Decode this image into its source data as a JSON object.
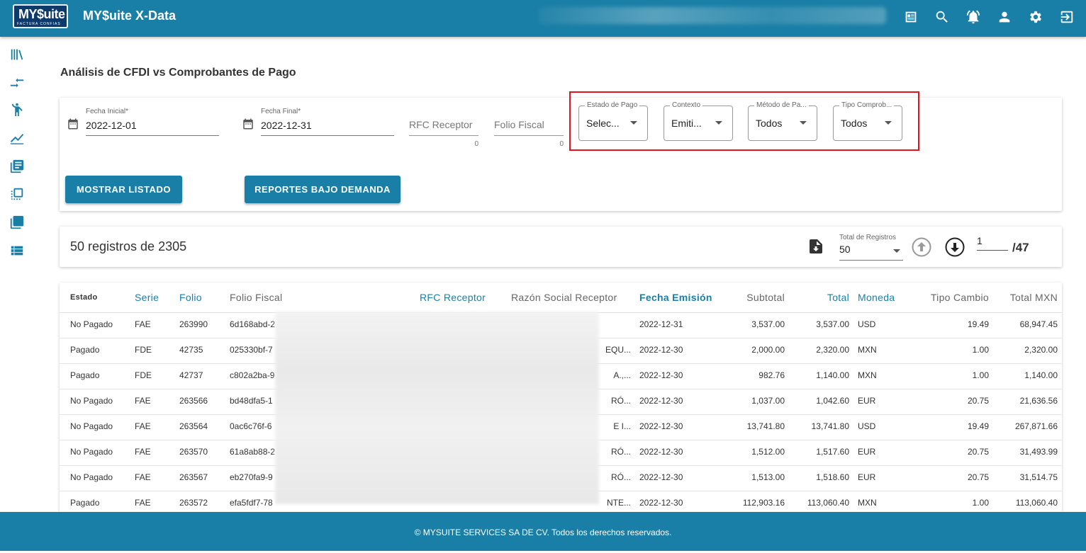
{
  "app": {
    "logo_text": "MY$uite",
    "logo_tagline": "FACTURA CONFIAS",
    "title": "MY$uite X-Data"
  },
  "colors": {
    "primary": "#1a7fa6",
    "highlight": "#e0141e"
  },
  "header_icons": [
    "news-icon",
    "search-icon",
    "notification-bell-icon",
    "user-icon",
    "gear-icon",
    "logout-icon"
  ],
  "sidebar_icons": [
    "library-icon",
    "swap-arrows-icon",
    "person-icon",
    "line-chart-icon",
    "library-books-icon",
    "flip-to-front-icon",
    "layers-icon",
    "list-icon"
  ],
  "page": {
    "title": "Análisis de CFDI vs Comprobantes de Pago"
  },
  "filters": {
    "fecha_inicial": {
      "label": "Fecha Inicial*",
      "value": "2022-12-01"
    },
    "fecha_final": {
      "label": "Fecha Final*",
      "value": "2022-12-31"
    },
    "rfc_receptor": {
      "placeholder": "RFC Receptor",
      "count": "0"
    },
    "folio_fiscal": {
      "placeholder": "Folio Fiscal",
      "count": "0"
    },
    "estado_pago": {
      "label": "Estado de Pago",
      "value": "Selec..."
    },
    "contexto": {
      "label": "Contexto",
      "value": "Emiti..."
    },
    "metodo_pago": {
      "label": "Método de Pa...",
      "value": "Todos"
    },
    "tipo_comprobante": {
      "label": "Tipo Comprob...",
      "value": "Todos"
    }
  },
  "actions": {
    "mostrar": "MOSTRAR LISTADO",
    "reportes": "REPORTES BAJO DEMANDA"
  },
  "summary": {
    "count_text": "50 registros de 2305",
    "total_label": "Total de Registros",
    "per_page": "50",
    "current_page": "1",
    "total_pages": "/47"
  },
  "table": {
    "columns": [
      "Estado",
      "Serie",
      "Folio",
      "Folio Fiscal",
      "RFC Receptor",
      "Razón Social Receptor",
      "Fecha Emisión",
      "Subtotal",
      "Total",
      "Moneda",
      "Tipo Cambio",
      "Total MXN"
    ],
    "rows": [
      [
        "No Pagado",
        "FAE",
        "263990",
        "6d168abd-2",
        "",
        "",
        "2022-12-31",
        "3,537.00",
        "3,537.00",
        "USD",
        "19.49",
        "68,947.45"
      ],
      [
        "Pagado",
        "FDE",
        "42735",
        "025330bf-7",
        "",
        "EQU...",
        "2022-12-30",
        "2,000.00",
        "2,320.00",
        "MXN",
        "1.00",
        "2,320.00"
      ],
      [
        "Pagado",
        "FDE",
        "42737",
        "c802a2ba-9",
        "",
        "A.,...",
        "2022-12-30",
        "982.76",
        "1,140.00",
        "MXN",
        "1.00",
        "1,140.00"
      ],
      [
        "No Pagado",
        "FAE",
        "263566",
        "bd48dfa5-1",
        "",
        "RÓ...",
        "2022-12-30",
        "1,037.00",
        "1,042.60",
        "EUR",
        "20.75",
        "21,636.56"
      ],
      [
        "No Pagado",
        "FAE",
        "263564",
        "0ac6c76f-6",
        "",
        "E I...",
        "2022-12-30",
        "13,741.80",
        "13,741.80",
        "USD",
        "19.49",
        "267,871.66"
      ],
      [
        "No Pagado",
        "FAE",
        "263570",
        "61a8ab88-2",
        "",
        "RÓ...",
        "2022-12-30",
        "1,512.00",
        "1,517.60",
        "EUR",
        "20.75",
        "31,493.99"
      ],
      [
        "No Pagado",
        "FAE",
        "263567",
        "eb270fa9-9",
        "",
        "RÓ...",
        "2022-12-30",
        "1,513.00",
        "1,518.60",
        "EUR",
        "20.75",
        "31,514.75"
      ],
      [
        "Pagado",
        "FAE",
        "263572",
        "efa5fdf7-78",
        "",
        "NTE...",
        "2022-12-30",
        "112,903.16",
        "113,060.40",
        "MXN",
        "1.00",
        "113,060.40"
      ]
    ]
  },
  "footer": {
    "text": "© MYSUITE SERVICES SA DE CV. Todos los derechos reservados."
  }
}
